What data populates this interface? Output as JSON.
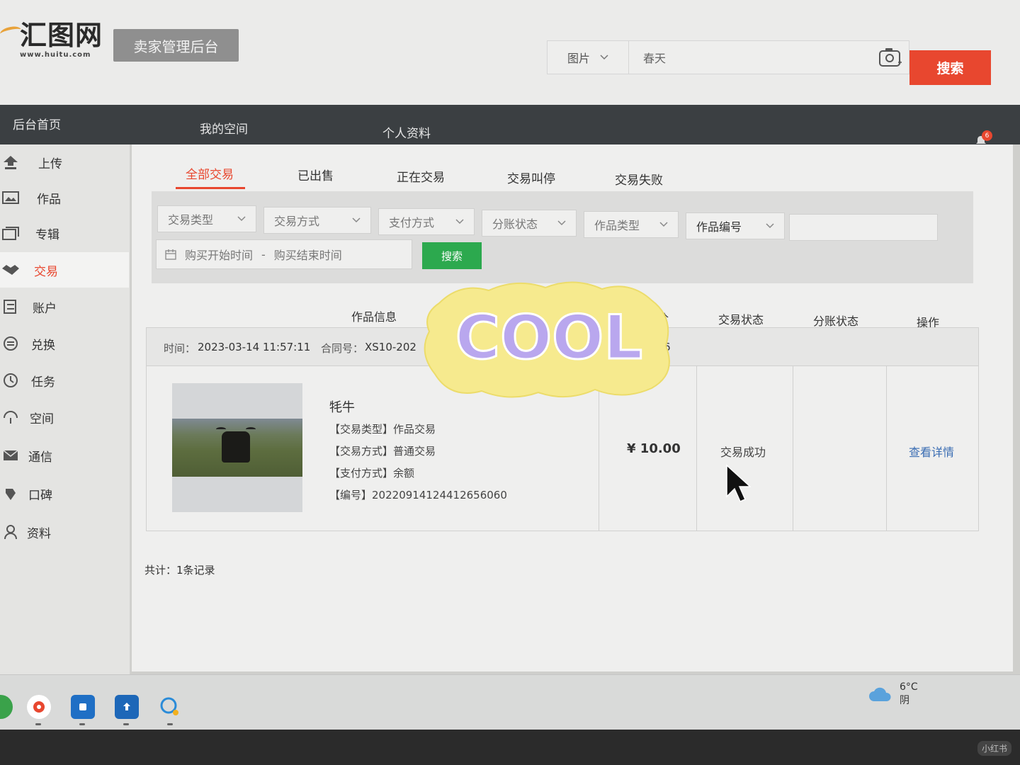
{
  "header": {
    "logo_text": "汇图网",
    "logo_url": "www.huitu.com",
    "seller_badge": "卖家管理后台",
    "search_category": "图片",
    "search_value": "春天",
    "search_button": "搜索"
  },
  "nav": {
    "items": [
      "后台首页",
      "我的空间",
      "个人资料"
    ],
    "notification_count": "6"
  },
  "sidebar": {
    "items": [
      {
        "label": "上传",
        "icon": "upload-icon"
      },
      {
        "label": "作品",
        "icon": "image-icon"
      },
      {
        "label": "专辑",
        "icon": "album-icon"
      },
      {
        "label": "交易",
        "icon": "handshake-icon",
        "active": true
      },
      {
        "label": "账户",
        "icon": "account-icon"
      },
      {
        "label": "兑换",
        "icon": "exchange-icon"
      },
      {
        "label": "任务",
        "icon": "clock-icon"
      },
      {
        "label": "空间",
        "icon": "space-icon"
      },
      {
        "label": "通信",
        "icon": "mail-icon"
      },
      {
        "label": "口碑",
        "icon": "reputation-icon"
      },
      {
        "label": "资料",
        "icon": "profile-icon"
      }
    ]
  },
  "tabs": [
    "全部交易",
    "已出售",
    "正在交易",
    "交易叫停",
    "交易失败"
  ],
  "filters": {
    "trade_type": "交易类型",
    "trade_method": "交易方式",
    "pay_method": "支付方式",
    "split_status": "分账状态",
    "work_type": "作品类型",
    "work_number": "作品编号",
    "start_time": "购买开始时间",
    "separator": "-",
    "end_time": "购买结束时间",
    "search_button": "搜索"
  },
  "table": {
    "headers": {
      "info": "作品信息",
      "price": "价",
      "trade_status": "交易状态",
      "split_status": "分账状态",
      "action": "操作"
    },
    "order": {
      "time_label": "时间：",
      "time": "2023-03-14 11:57:11",
      "contract_label": "合同号：",
      "contract": "XS10-202",
      "contract_tail": "6",
      "title": "牦牛",
      "lines": [
        {
          "key": "【交易类型】",
          "value": "作品交易"
        },
        {
          "key": "【交易方式】",
          "value": "普通交易"
        },
        {
          "key": "【支付方式】",
          "value": "余额"
        },
        {
          "key": "【编号】",
          "value": "20220914124412656060"
        }
      ],
      "price": "¥ 10.00",
      "status": "交易成功",
      "action": "查看详情"
    },
    "total": "共计：",
    "total_count": "1条记录"
  },
  "sticker": {
    "text": "COOL"
  },
  "taskbar": {
    "icons": [
      "browser-icon",
      "app-icon",
      "blue-app-icon",
      "upload-app-icon",
      "chat-icon"
    ],
    "temperature": "6°C",
    "weather": "阴"
  },
  "watermark": "小红书",
  "colors": {
    "accent": "#e8472f",
    "nav_bg": "#3b3f42",
    "search_green": "#2ca94e",
    "link": "#3a6db3"
  }
}
